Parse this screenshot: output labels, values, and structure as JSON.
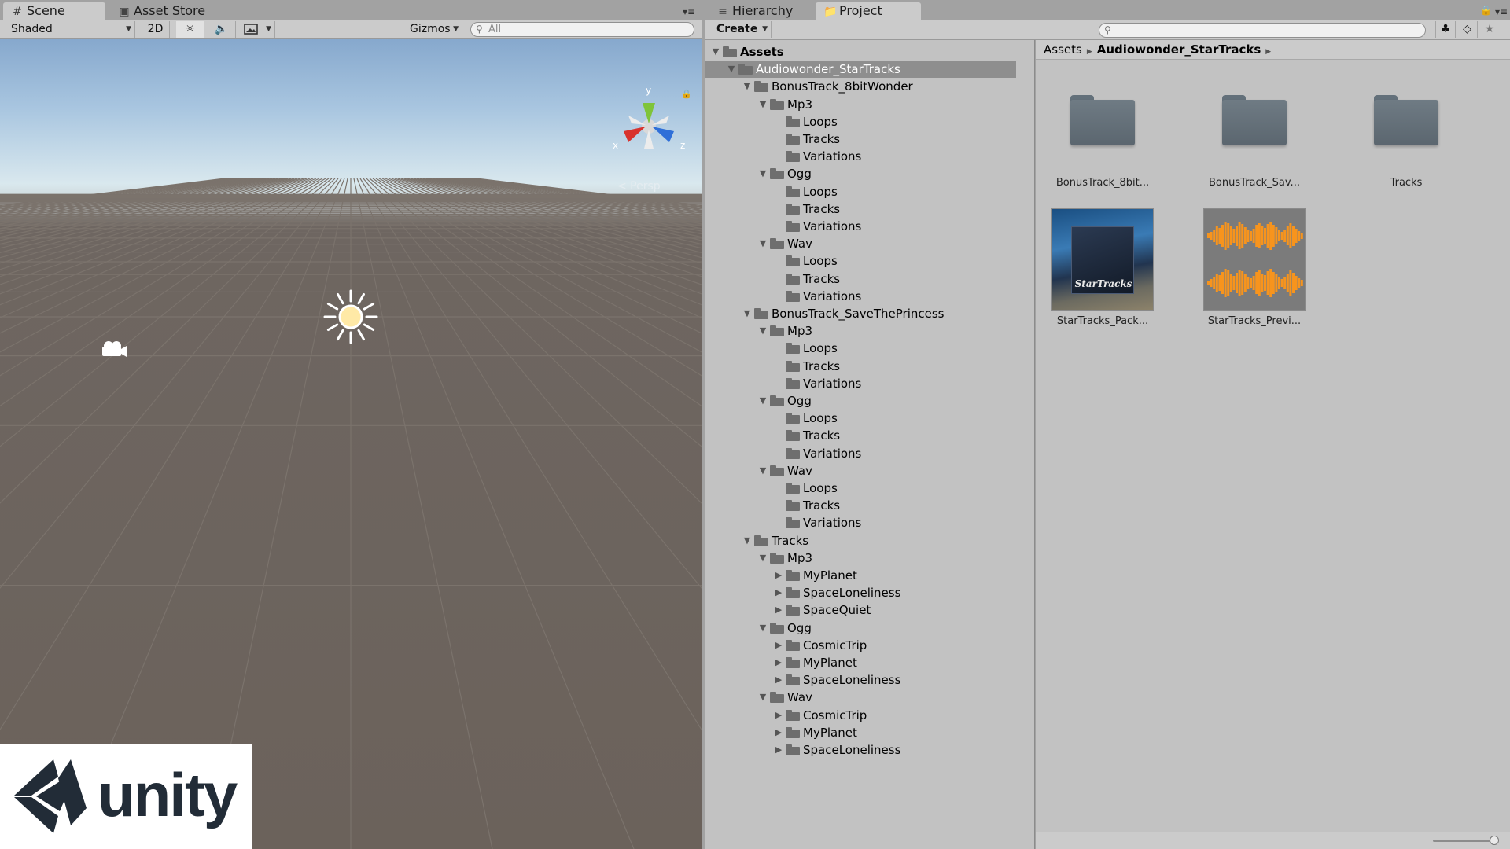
{
  "scene_panel": {
    "tabs": [
      {
        "label": "Scene",
        "icon": "hash-icon"
      },
      {
        "label": "Asset Store",
        "icon": "bag-icon"
      }
    ],
    "toolbar": {
      "shading_mode": "Shaded",
      "mode_2d": "2D",
      "gizmos_label": "Gizmos",
      "search_placeholder": "All"
    },
    "gizmo_axes": {
      "x": "x",
      "y": "y",
      "z": "z"
    },
    "persp_label": "< Persp"
  },
  "branding": {
    "logo_text": "unity"
  },
  "project_panel": {
    "tabs": [
      {
        "label": "Hierarchy",
        "icon": "list-icon"
      },
      {
        "label": "Project",
        "icon": "folder-icon"
      }
    ],
    "toolbar": {
      "create_label": "Create",
      "search_placeholder": ""
    },
    "tree": [
      {
        "label": "Assets",
        "depth": 0,
        "expanded": true,
        "bold": true
      },
      {
        "label": "Audiowonder_StarTracks",
        "depth": 1,
        "expanded": true,
        "selected": true
      },
      {
        "label": "BonusTrack_8bitWonder",
        "depth": 2,
        "expanded": true
      },
      {
        "label": "Mp3",
        "depth": 3,
        "expanded": true
      },
      {
        "label": "Loops",
        "depth": 4
      },
      {
        "label": "Tracks",
        "depth": 4
      },
      {
        "label": "Variations",
        "depth": 4
      },
      {
        "label": "Ogg",
        "depth": 3,
        "expanded": true
      },
      {
        "label": "Loops",
        "depth": 4
      },
      {
        "label": "Tracks",
        "depth": 4
      },
      {
        "label": "Variations",
        "depth": 4
      },
      {
        "label": "Wav",
        "depth": 3,
        "expanded": true
      },
      {
        "label": "Loops",
        "depth": 4
      },
      {
        "label": "Tracks",
        "depth": 4
      },
      {
        "label": "Variations",
        "depth": 4
      },
      {
        "label": "BonusTrack_SaveThePrincess",
        "depth": 2,
        "expanded": true
      },
      {
        "label": "Mp3",
        "depth": 3,
        "expanded": true
      },
      {
        "label": "Loops",
        "depth": 4
      },
      {
        "label": "Tracks",
        "depth": 4
      },
      {
        "label": "Variations",
        "depth": 4
      },
      {
        "label": "Ogg",
        "depth": 3,
        "expanded": true
      },
      {
        "label": "Loops",
        "depth": 4
      },
      {
        "label": "Tracks",
        "depth": 4
      },
      {
        "label": "Variations",
        "depth": 4
      },
      {
        "label": "Wav",
        "depth": 3,
        "expanded": true
      },
      {
        "label": "Loops",
        "depth": 4
      },
      {
        "label": "Tracks",
        "depth": 4
      },
      {
        "label": "Variations",
        "depth": 4
      },
      {
        "label": "Tracks",
        "depth": 2,
        "expanded": true
      },
      {
        "label": "Mp3",
        "depth": 3,
        "expanded": true
      },
      {
        "label": "MyPlanet",
        "depth": 4,
        "collapsed": true
      },
      {
        "label": "SpaceLoneliness",
        "depth": 4,
        "collapsed": true
      },
      {
        "label": "SpaceQuiet",
        "depth": 4,
        "collapsed": true
      },
      {
        "label": "Ogg",
        "depth": 3,
        "expanded": true
      },
      {
        "label": "CosmicTrip",
        "depth": 4,
        "collapsed": true
      },
      {
        "label": "MyPlanet",
        "depth": 4,
        "collapsed": true
      },
      {
        "label": "SpaceLoneliness",
        "depth": 4,
        "collapsed": true
      },
      {
        "label": "Wav",
        "depth": 3,
        "expanded": true
      },
      {
        "label": "CosmicTrip",
        "depth": 4,
        "collapsed": true
      },
      {
        "label": "MyPlanet",
        "depth": 4,
        "collapsed": true
      },
      {
        "label": "SpaceLoneliness",
        "depth": 4,
        "collapsed": true
      }
    ],
    "breadcrumb": [
      "Assets",
      "Audiowonder_StarTracks"
    ],
    "assets": [
      {
        "label": "BonusTrack_8bit...",
        "kind": "folder"
      },
      {
        "label": "BonusTrack_Sav...",
        "kind": "folder"
      },
      {
        "label": "Tracks",
        "kind": "folder"
      },
      {
        "label": "StarTracks_Pack...",
        "kind": "image"
      },
      {
        "label": "StarTracks_Previ...",
        "kind": "audio"
      }
    ],
    "pack_thumb_title": "StarTracks"
  },
  "colors": {
    "panel_bg": "#c2c2c2",
    "toolbar_bg": "#cbcbcb",
    "selection": "#8e8e8e",
    "folder_icon": "#6e6e6e",
    "waveform": "#f7941d",
    "axis_x": "#d8322c",
    "axis_y": "#7fc43a",
    "axis_z": "#2f6fd8"
  }
}
